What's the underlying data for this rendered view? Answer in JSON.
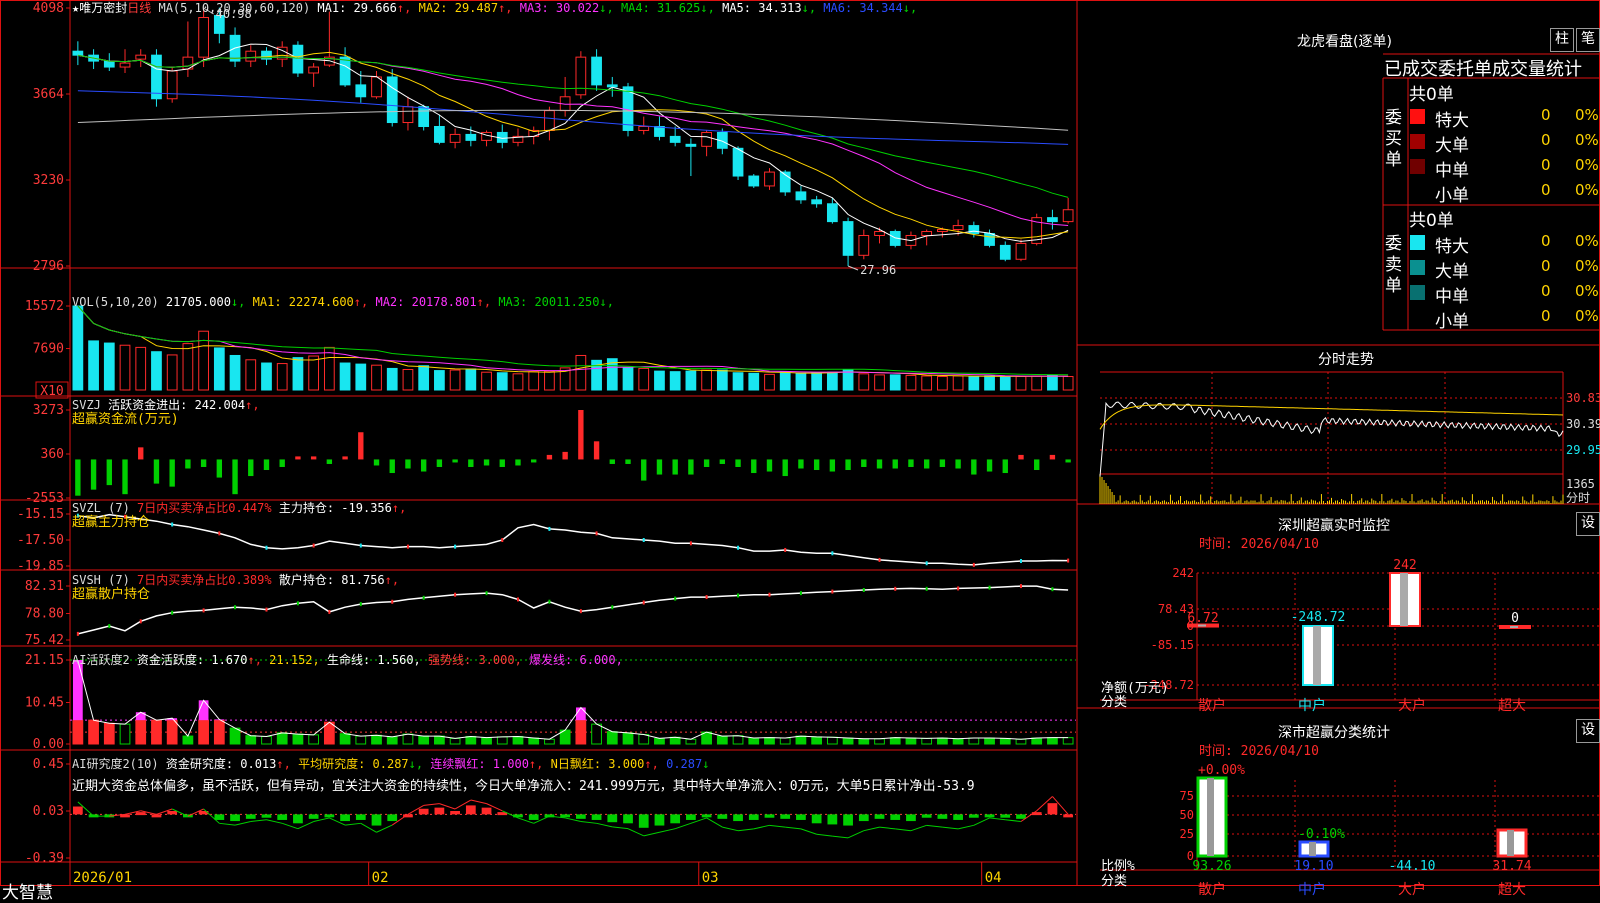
{
  "colors": {
    "up": "#ff2a2a",
    "down": "#19e6f0",
    "grid": "#d11",
    "yellow": "#ffd400",
    "magenta": "#ff33ff",
    "green": "#00d000",
    "blue": "#2a4cff",
    "white": "#ffffff",
    "gray": "#c0c0c0"
  },
  "main": {
    "stock_name": "★唯万密封",
    "period": "日线",
    "ma_title": "MA(5,10,20,30,60,120)",
    "ma_values": [
      {
        "label": "MA1:",
        "value": "29.666",
        "arrow": "↑",
        "color": "#ffffff"
      },
      {
        "label": "MA2:",
        "value": "29.487",
        "arrow": "↑",
        "color": "#ffd400"
      },
      {
        "label": "MA3:",
        "value": "30.022",
        "arrow": "↓",
        "color": "#ff33ff"
      },
      {
        "label": "MA4:",
        "value": "31.625",
        "arrow": "↓",
        "color": "#00d000"
      },
      {
        "label": "MA5:",
        "value": "34.313",
        "arrow": "↓",
        "color": "#ffffff"
      },
      {
        "label": "MA6:",
        "value": "34.344",
        "arrow": "↓",
        "color": "#2a4cff"
      }
    ],
    "y_ticks": [
      "4098",
      "3664",
      "3230",
      "2796"
    ],
    "high_label": "40.98",
    "low_label": "27.96"
  },
  "vol": {
    "title": "VOL(5,10,20)",
    "value": "21705.000",
    "arrow": "↓",
    "ma": [
      {
        "label": "MA1:",
        "value": "22274.600",
        "arrow": "↑",
        "color": "#ffd400"
      },
      {
        "label": "MA2:",
        "value": "20178.801",
        "arrow": "↑",
        "color": "#ff33ff"
      },
      {
        "label": "MA3:",
        "value": "20011.250",
        "arrow": "↓",
        "color": "#00d000"
      }
    ],
    "y_ticks": [
      "15572",
      "7690"
    ],
    "unit": "X10"
  },
  "svzj": {
    "title": "SVZJ",
    "label": "活跃资金进出:",
    "value": "242.004",
    "arrow": "↑",
    "sub": "超赢资金流(万元)",
    "y_ticks": [
      "3273",
      "360",
      "-2553"
    ]
  },
  "svzl": {
    "title": "SVZL (7)",
    "pct_label": "7日内买卖净占比0.447%",
    "label": "主力持仓:",
    "value": "-19.356",
    "arrow": "↑",
    "sub": "超赢主力持仓",
    "y_ticks": [
      "-15.15",
      "-17.50",
      "-19.85"
    ]
  },
  "svsh": {
    "title": "SVSH (7)",
    "pct_label": "7日内买卖净占比0.389%",
    "label": "散户持仓:",
    "value": "81.756",
    "arrow": "↑",
    "sub": "超赢散户持仓",
    "y_ticks": [
      "82.31",
      "78.80",
      "75.42"
    ]
  },
  "ai_active": {
    "title": "AI活跃度2",
    "label": "资金活跃度:",
    "value": "1.670",
    "arrow": "↑",
    "v2": "21.152",
    "life_label": "生命线:",
    "life_value": "1.560",
    "strong": "强势线: 3.000",
    "burst": "爆发线: 6.000",
    "y_ticks": [
      "21.15",
      "10.45",
      "0.00"
    ]
  },
  "ai_research": {
    "title": "AI研究度2(10)",
    "label": "资金研究度:",
    "value": "0.013",
    "arrow": "↑",
    "avg": "平均研究度: 0.287",
    "avg_arrow": "↓",
    "cont": "连续飘红: 1.000",
    "cont_arrow": "↑",
    "ndays": "N日飘红: 3.000",
    "ndays_arrow": "↑",
    "last": "0.287",
    "last_arrow": "↓",
    "y_ticks": [
      "0.45",
      "0.03",
      "-0.39"
    ],
    "commentary": "近期大资金总体偏多，虽不活跃，但有异动，宜关注大资金的持续性，今日大单净流入：241.999万元，其中特大单净流入：0万元，大单5日累计净出-53.9"
  },
  "x_axis": {
    "labels": [
      "2026/01",
      "02",
      "03",
      "04"
    ]
  },
  "brand": "大智慧",
  "right": {
    "dragon_title": "龙虎看盘(逐单)",
    "btn_col": "柱",
    "btn_pen": "笔",
    "table_title": "已成交委托单成交量统计",
    "buy": {
      "side": "委买单",
      "total": "共0单",
      "rows": [
        {
          "name": "特大",
          "val": "0",
          "pct": "0%",
          "color": "#ff1010"
        },
        {
          "name": "大单",
          "val": "0",
          "pct": "0%",
          "color": "#a00000"
        },
        {
          "name": "中单",
          "val": "0",
          "pct": "0%",
          "color": "#700000"
        },
        {
          "name": "小单",
          "val": "0",
          "pct": "0%",
          "color": "#000000"
        }
      ]
    },
    "sell": {
      "side": "委卖单",
      "total": "共0单",
      "rows": [
        {
          "name": "特大",
          "val": "0",
          "pct": "0%",
          "color": "#19e6f0"
        },
        {
          "name": "大单",
          "val": "0",
          "pct": "0%",
          "color": "#0a9090"
        },
        {
          "name": "中单",
          "val": "0",
          "pct": "0%",
          "color": "#087070"
        },
        {
          "name": "小单",
          "val": "0",
          "pct": "0%",
          "color": "#000000"
        }
      ]
    },
    "intraday": {
      "title": "分时走势",
      "y_ticks": [
        "30.83",
        "30.39",
        "29.95"
      ],
      "vol_tick": "1365",
      "unit": "分时"
    },
    "sz_monitor": {
      "title": "深圳超赢实时监控",
      "btn": "设",
      "date_label": "时间: 2026/04/10",
      "y_ticks": [
        "242",
        "78.43",
        "0",
        "-85.15",
        "-248.72"
      ],
      "unit": "净额(万元)",
      "cat": "分类",
      "categories": [
        "散户",
        "中户",
        "大户",
        "超大"
      ],
      "values": [
        6.72,
        -248.72,
        242,
        0
      ],
      "value_labels": [
        "6.72",
        "-248.72",
        "242",
        "0"
      ]
    },
    "sz_class": {
      "title": "深市超赢分类统计",
      "btn": "设",
      "date_label": "时间: 2026/04/10",
      "y_ticks": [
        "75",
        "50",
        "25",
        "0"
      ],
      "unit": "比例%",
      "cat": "分类",
      "categories": [
        "散户",
        "中户",
        "大户",
        "超大"
      ],
      "values": [
        93.26,
        19.1,
        -44.1,
        31.74
      ],
      "top_labels": [
        "+0.00%",
        "-0.10%",
        "",
        ""
      ],
      "bottom_labels": [
        "93.26",
        "19.10",
        "-44.10",
        "31.74"
      ]
    }
  },
  "chart_data": {
    "type": "candlestick",
    "candles": [
      [
        38.8,
        39.3,
        38.1,
        38.6
      ],
      [
        38.6,
        38.9,
        37.9,
        38.3
      ],
      [
        38.3,
        38.7,
        37.8,
        38.0
      ],
      [
        38.0,
        38.9,
        37.7,
        38.2
      ],
      [
        38.4,
        38.9,
        38.0,
        38.6
      ],
      [
        38.6,
        38.9,
        36.0,
        36.4
      ],
      [
        36.4,
        38.0,
        36.2,
        37.8
      ],
      [
        37.9,
        40.3,
        37.5,
        38.5
      ],
      [
        38.5,
        40.98,
        38.0,
        40.5
      ],
      [
        40.6,
        41.0,
        39.2,
        39.7
      ],
      [
        39.6,
        40.0,
        38.0,
        38.3
      ],
      [
        38.3,
        39.1,
        38.0,
        38.8
      ],
      [
        38.8,
        39.0,
        38.1,
        38.4
      ],
      [
        38.4,
        39.3,
        38.0,
        39.0
      ],
      [
        39.1,
        39.3,
        37.5,
        37.7
      ],
      [
        37.7,
        38.2,
        37.0,
        38.0
      ],
      [
        38.1,
        40.8,
        38.0,
        38.5
      ],
      [
        38.5,
        39.0,
        37.0,
        37.1
      ],
      [
        37.1,
        37.8,
        36.2,
        36.5
      ],
      [
        36.5,
        37.8,
        36.4,
        37.5
      ],
      [
        37.5,
        37.9,
        35.0,
        35.2
      ],
      [
        35.2,
        36.5,
        34.8,
        36.0
      ],
      [
        36.0,
        36.1,
        34.8,
        35.0
      ],
      [
        35.0,
        35.6,
        34.1,
        34.2
      ],
      [
        34.2,
        34.9,
        33.9,
        34.6
      ],
      [
        34.6,
        35.0,
        34.0,
        34.3
      ],
      [
        34.3,
        34.8,
        34.0,
        34.7
      ],
      [
        34.7,
        35.1,
        33.9,
        34.2
      ],
      [
        34.2,
        34.9,
        34.0,
        34.5
      ],
      [
        34.5,
        35.0,
        34.1,
        34.8
      ],
      [
        34.8,
        36.0,
        34.3,
        35.8
      ],
      [
        35.8,
        37.5,
        35.5,
        36.5
      ],
      [
        36.6,
        38.8,
        36.4,
        38.5
      ],
      [
        38.5,
        38.9,
        36.8,
        37.1
      ],
      [
        37.1,
        37.5,
        36.5,
        37.0
      ],
      [
        37.0,
        37.2,
        34.5,
        34.8
      ],
      [
        34.8,
        35.5,
        34.6,
        35.0
      ],
      [
        35.0,
        35.5,
        34.3,
        34.5
      ],
      [
        34.5,
        35.0,
        34.0,
        34.2
      ],
      [
        34.1,
        34.4,
        32.5,
        34.0
      ],
      [
        34.0,
        34.8,
        33.5,
        34.7
      ],
      [
        34.7,
        34.9,
        33.6,
        33.9
      ],
      [
        33.9,
        34.0,
        32.3,
        32.5
      ],
      [
        32.5,
        32.6,
        31.9,
        32.0
      ],
      [
        32.0,
        32.9,
        31.8,
        32.7
      ],
      [
        32.7,
        32.8,
        31.5,
        31.7
      ],
      [
        31.7,
        32.0,
        31.1,
        31.3
      ],
      [
        31.3,
        31.5,
        30.9,
        31.1
      ],
      [
        31.1,
        31.4,
        30.1,
        30.2
      ],
      [
        30.2,
        30.4,
        27.96,
        28.5
      ],
      [
        28.5,
        29.8,
        28.3,
        29.5
      ],
      [
        29.5,
        29.9,
        29.1,
        29.7
      ],
      [
        29.7,
        29.8,
        28.9,
        29.0
      ],
      [
        29.0,
        29.7,
        28.8,
        29.5
      ],
      [
        29.5,
        29.8,
        29.0,
        29.7
      ],
      [
        29.7,
        29.9,
        29.4,
        29.8
      ],
      [
        29.8,
        30.3,
        29.5,
        30.0
      ],
      [
        30.0,
        30.2,
        29.4,
        29.6
      ],
      [
        29.6,
        29.8,
        28.9,
        29.0
      ],
      [
        29.0,
        29.2,
        28.2,
        28.3
      ],
      [
        28.3,
        29.3,
        28.2,
        29.1
      ],
      [
        29.1,
        30.6,
        29.0,
        30.4
      ],
      [
        30.4,
        30.8,
        29.8,
        30.2
      ],
      [
        30.2,
        31.4,
        30.1,
        30.8
      ]
    ],
    "volume": [
      15572,
      9100,
      8700,
      8300,
      7900,
      7100,
      6500,
      8600,
      10900,
      7800,
      6400,
      5600,
      5000,
      4900,
      6000,
      6300,
      7900,
      5000,
      4800,
      4600,
      4000,
      3800,
      4500,
      3600,
      3700,
      3900,
      3300,
      3200,
      3000,
      3400,
      3500,
      4100,
      6400,
      5500,
      5800,
      4100,
      4000,
      3500,
      3400,
      3500,
      3700,
      3700,
      3200,
      3100,
      2900,
      3400,
      3100,
      3200,
      3300,
      3800,
      3000,
      2800,
      2800,
      2700,
      2600,
      2500,
      2600,
      2500,
      2600,
      2400,
      2500,
      2600,
      2700,
      2500
    ],
    "svzj": [
      -2400,
      -2000,
      -1700,
      -2300,
      800,
      -1600,
      -1800,
      -600,
      -500,
      -1200,
      -2300,
      -1100,
      -700,
      -500,
      200,
      200,
      -300,
      200,
      1800,
      -400,
      -900,
      -600,
      -800,
      -500,
      -200,
      -500,
      -400,
      -500,
      -400,
      -200,
      300,
      500,
      3273,
      1200,
      -300,
      -300,
      -1400,
      -1000,
      -1000,
      -1000,
      -500,
      -300,
      -500,
      -900,
      -800,
      -1100,
      -600,
      -700,
      -800,
      -700,
      -500,
      -600,
      -600,
      -500,
      -600,
      -500,
      -600,
      -1000,
      -800,
      -900,
      300,
      -700,
      300,
      -200
    ],
    "svzl": [
      -15.3,
      -15.5,
      -15.2,
      -15.4,
      -15.6,
      -15.8,
      -16.1,
      -16.3,
      -16.6,
      -16.9,
      -17.3,
      -17.9,
      -18.2,
      -18.3,
      -18.2,
      -18.0,
      -17.6,
      -17.8,
      -18.0,
      -18.1,
      -18.2,
      -18.1,
      -18.1,
      -18.2,
      -18.1,
      -18.0,
      -17.9,
      -17.5,
      -16.4,
      -16.1,
      -16.5,
      -16.6,
      -16.8,
      -16.9,
      -17.3,
      -17.4,
      -17.5,
      -17.6,
      -17.8,
      -17.8,
      -17.9,
      -18.0,
      -18.2,
      -18.5,
      -18.5,
      -18.4,
      -18.6,
      -18.7,
      -18.7,
      -18.9,
      -19.1,
      -19.3,
      -19.4,
      -19.5,
      -19.6,
      -19.6,
      -19.7,
      -19.75,
      -19.6,
      -19.5,
      -19.4,
      -19.4,
      -19.35,
      -19.36
    ],
    "svsh": [
      76.2,
      76.7,
      77.2,
      76.6,
      77.8,
      78.5,
      78.9,
      79.1,
      79.2,
      79.4,
      79.6,
      79.5,
      79.3,
      79.8,
      80.1,
      80.3,
      79.0,
      79.6,
      80.0,
      80.2,
      80.3,
      80.6,
      80.8,
      81.0,
      81.2,
      81.3,
      81.4,
      81.2,
      80.6,
      79.5,
      80.3,
      79.6,
      79.1,
      79.3,
      79.6,
      79.9,
      80.2,
      80.5,
      80.7,
      80.9,
      80.9,
      81.0,
      81.1,
      81.2,
      81.2,
      81.3,
      81.4,
      81.5,
      81.6,
      81.7,
      81.8,
      81.9,
      81.95,
      82.0,
      81.95,
      81.9,
      82.0,
      82.05,
      82.1,
      82.2,
      82.3,
      82.3,
      81.9,
      81.8
    ],
    "ai_active": [
      21.15,
      6.0,
      5.2,
      5.0,
      8.0,
      6.0,
      6.5,
      2.0,
      11.0,
      6.2,
      4.0,
      2.1,
      1.9,
      2.8,
      2.5,
      2.3,
      5.5,
      2.6,
      2.0,
      2.2,
      1.8,
      2.5,
      2.0,
      2.0,
      1.4,
      1.9,
      1.6,
      1.8,
      1.9,
      1.5,
      1.2,
      3.5,
      9.2,
      5.0,
      3.1,
      2.8,
      2.4,
      1.4,
      1.7,
      1.2,
      3.0,
      2.0,
      2.1,
      1.5,
      1.6,
      1.5,
      2.0,
      1.8,
      1.7,
      1.5,
      1.3,
      1.3,
      1.6,
      1.5,
      1.4,
      1.5,
      1.3,
      1.5,
      1.5,
      1.4,
      1.2,
      1.5,
      1.6,
      1.6
    ],
    "ai_research": [
      0.07,
      -0.01,
      -0.01,
      0.0,
      0.02,
      0.0,
      0.03,
      -0.01,
      0.03,
      -0.05,
      -0.06,
      -0.04,
      -0.03,
      -0.05,
      -0.08,
      -0.04,
      -0.02,
      -0.06,
      -0.05,
      -0.1,
      -0.06,
      0.0,
      0.05,
      0.06,
      0.03,
      0.08,
      0.06,
      0.02,
      -0.02,
      -0.05,
      -0.01,
      -0.02,
      -0.04,
      -0.05,
      -0.07,
      -0.08,
      -0.12,
      -0.1,
      -0.08,
      -0.05,
      -0.02,
      -0.04,
      -0.06,
      -0.05,
      -0.03,
      -0.04,
      -0.05,
      -0.08,
      -0.09,
      -0.1,
      -0.06,
      -0.04,
      -0.05,
      -0.06,
      -0.03,
      -0.04,
      -0.05,
      -0.03,
      -0.02,
      -0.03,
      -0.04,
      0.02,
      0.1,
      0.0
    ],
    "y_ranges": {
      "main": [
        27.96,
        40.98
      ],
      "vol": [
        0,
        15572
      ],
      "svzj": [
        -2553,
        3273
      ],
      "svzl": [
        -19.85,
        -15.15
      ],
      "svsh": [
        75.42,
        82.31
      ],
      "ai_active": [
        0,
        21.15
      ],
      "ai_research": [
        -0.39,
        0.45
      ]
    }
  }
}
